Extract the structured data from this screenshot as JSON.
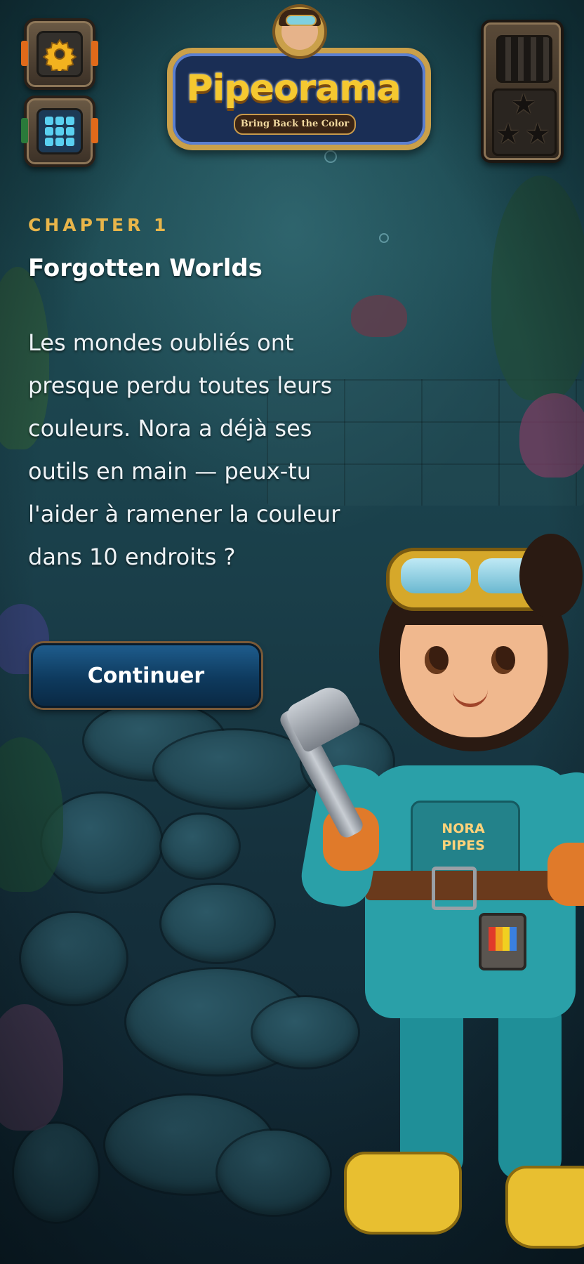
{
  "logo": {
    "title": "Pipeorama",
    "subtitle": "Bring Back the Color"
  },
  "hud": {
    "settings_icon": "gear-icon",
    "menu_icon": "grid-icon",
    "stars_icon": "star-icon"
  },
  "chapter": {
    "label": "CHAPTER 1",
    "title": "Forgotten Worlds",
    "body": "Les mondes oubliés ont presque perdu toutes leurs couleurs. Nora a déjà ses outils en main — peux-tu l'aider à ramener la couleur dans 10 endroits ?",
    "continue_label": "Continuer"
  },
  "character": {
    "badge": "NORA PIPES"
  },
  "colors": {
    "accent_gold": "#e8b54a",
    "button_blue": "#0e3a5e",
    "background": "#17424a"
  }
}
